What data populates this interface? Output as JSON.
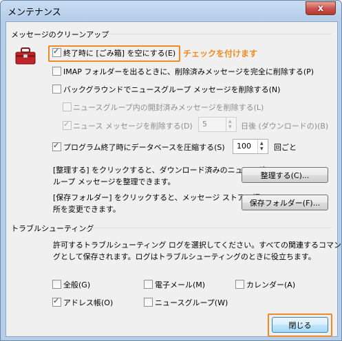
{
  "window": {
    "title": "メンテナンス",
    "close_glyph": "x"
  },
  "cleanup": {
    "group_title": "メッセージのクリーンアップ",
    "empty_trash": {
      "label": "終了時に [ごみ箱] を空にする(E)",
      "checked": true
    },
    "annotation": "チェックを付けます",
    "imap": {
      "label": "IMAP フォルダーを出るときに、削除済みメッセージを完全に削除する(P)",
      "checked": false
    },
    "background_delete": {
      "label": "バックグラウンドでニュースグループ メッセージを削除する(N)",
      "checked": false
    },
    "delete_read": {
      "label": "ニュースグループ内の開封済みメッセージを削除する(L)",
      "checked": false,
      "disabled": true
    },
    "delete_news": {
      "label": "ニュース メッセージを削除する(D)",
      "checked": true,
      "disabled": true,
      "days": "5",
      "days_suffix": "日後 (ダウンロードの)(B)"
    },
    "compact": {
      "label": "プログラム終了時にデータベースを圧縮する(S)",
      "checked": true,
      "value": "100",
      "suffix": "回ごと"
    },
    "cleanup_text": "[整理する] をクリックすると、ダウンロード済みのニュースグ\nループ メッセージを整理できます。",
    "cleanup_button": "整理する(C)...",
    "store_text": "[保存フォルダー] をクリックすると、メッセージ ストアの場\n所を変更できます。",
    "store_button": "保存フォルダー(F)..."
  },
  "troubleshooting": {
    "group_title": "トラブルシューティング",
    "description": "許可するトラブルシューティング ログを選択してください。すべての関連するコマンドがロ\nグとして保存されます。ログはトラブルシューティングのときに役立ちます。",
    "options": [
      {
        "label": "全般(G)",
        "checked": false
      },
      {
        "label": "電子メール(M)",
        "checked": false
      },
      {
        "label": "カレンダー(A)",
        "checked": false
      },
      {
        "label": "アドレス帳(O)",
        "checked": true
      },
      {
        "label": "ニュースグループ(W)",
        "checked": false
      }
    ]
  },
  "close_button": "閉じる",
  "colors": {
    "highlight": "#f08a24",
    "titlebar": "#b4cde9"
  },
  "icons": {
    "toolbox": "toolbox-icon"
  }
}
